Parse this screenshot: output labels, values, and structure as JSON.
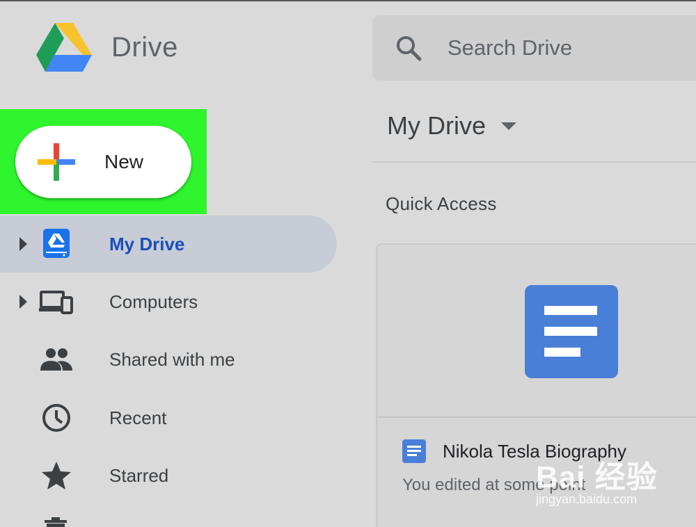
{
  "app": {
    "name": "Drive"
  },
  "search": {
    "placeholder": "Search Drive"
  },
  "new_button": {
    "label": "New"
  },
  "sidebar": {
    "items": [
      {
        "label": "My Drive",
        "icon": "drive-icon",
        "active": true,
        "expandable": true
      },
      {
        "label": "Computers",
        "icon": "computers-icon",
        "active": false,
        "expandable": true
      },
      {
        "label": "Shared with me",
        "icon": "people-icon",
        "active": false,
        "expandable": false
      },
      {
        "label": "Recent",
        "icon": "clock-icon",
        "active": false,
        "expandable": false
      },
      {
        "label": "Starred",
        "icon": "star-icon",
        "active": false,
        "expandable": false
      }
    ]
  },
  "main": {
    "title": "My Drive",
    "quick_access_label": "Quick Access",
    "files": [
      {
        "name": "Nikola Tesla Biography",
        "meta": "You edited at some point",
        "type": "docs-icon"
      }
    ]
  },
  "watermark": {
    "mark": "Bai 经验",
    "url": "jingyan.baidu.com"
  },
  "colors": {
    "highlight": "#2ef52e",
    "active_nav_text": "#1a4fb8",
    "docs_blue": "#4a7fd8"
  }
}
